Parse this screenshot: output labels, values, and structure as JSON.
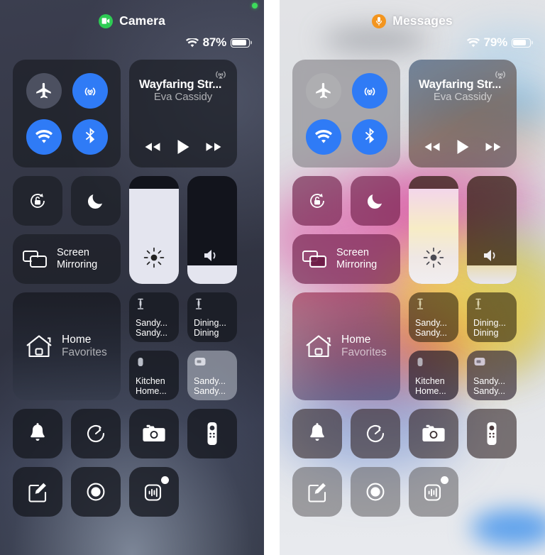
{
  "panels": [
    {
      "theme": "dark",
      "header": {
        "app_indicator_icon": "camera-icon",
        "app_indicator_label": "Camera",
        "app_indicator_color": "#2ecb54",
        "wifi_icon": "wifi-icon",
        "battery_percent": "87%",
        "battery_level": 87,
        "recording_dot": true
      },
      "connectivity": {
        "airplane": {
          "label": "Airplane Mode",
          "icon": "airplane-icon",
          "state": "off"
        },
        "airdrop": {
          "label": "AirDrop",
          "icon": "airdrop-icon",
          "state": "on"
        },
        "wifi": {
          "label": "Wi-Fi",
          "icon": "wifi-icon",
          "state": "on"
        },
        "bluetooth": {
          "label": "Bluetooth",
          "icon": "bluetooth-icon",
          "state": "on"
        }
      },
      "music": {
        "airplay_icon": "airplay-audio-icon",
        "title": "Wayfaring Str...",
        "artist": "Eva Cassidy",
        "prev_icon": "rewind-icon",
        "play_icon": "play-icon",
        "next_icon": "fast-forward-icon"
      },
      "controls": {
        "rotation_lock": {
          "icon": "rotation-lock-icon",
          "state": "off"
        },
        "do_not_disturb": {
          "icon": "moon-icon",
          "state": "off"
        },
        "screen_mirroring": {
          "icon": "screen-mirroring-icon",
          "line1": "Screen",
          "line2": "Mirroring"
        },
        "brightness": {
          "icon": "brightness-icon",
          "value": 88
        },
        "volume": {
          "icon": "speaker-icon",
          "value": 17
        }
      },
      "home": {
        "icon": "home-icon",
        "line1": "Home",
        "line2": "Favorites",
        "accessories": [
          {
            "icon": "lamp-icon",
            "line1": "Sandy...",
            "line2": "Sandy...",
            "active": false
          },
          {
            "icon": "lamp-icon",
            "line1": "Dining...",
            "line2": "Dining",
            "active": false
          },
          {
            "icon": "speaker-device-icon",
            "line1": "Kitchen",
            "line2": "Home...",
            "active": false
          },
          {
            "icon": "tv-device-icon",
            "line1": "Sandy...",
            "line2": "Sandy...",
            "active": true
          }
        ]
      },
      "shortcuts_row1": [
        {
          "icon": "bell-icon",
          "label": "Alarm"
        },
        {
          "icon": "timer-icon",
          "label": "Timer"
        },
        {
          "icon": "camera-body-icon",
          "label": "Camera"
        },
        {
          "icon": "remote-icon",
          "label": "Apple TV Remote"
        }
      ],
      "shortcuts_row2": [
        {
          "icon": "notes-icon",
          "label": "Notes"
        },
        {
          "icon": "screen-record-icon",
          "label": "Screen Recording"
        },
        {
          "icon": "sound-recognition-icon",
          "label": "Sound Recognition",
          "badge": true
        }
      ]
    },
    {
      "theme": "light",
      "header": {
        "app_indicator_icon": "microphone-icon",
        "app_indicator_label": "Messages",
        "app_indicator_color": "#f3951f",
        "wifi_icon": "wifi-icon",
        "battery_percent": "79%",
        "battery_level": 79,
        "recording_dot": false
      },
      "connectivity": {
        "airplane": {
          "label": "Airplane Mode",
          "icon": "airplane-icon",
          "state": "off"
        },
        "airdrop": {
          "label": "AirDrop",
          "icon": "airdrop-icon",
          "state": "on"
        },
        "wifi": {
          "label": "Wi-Fi",
          "icon": "wifi-icon",
          "state": "on"
        },
        "bluetooth": {
          "label": "Bluetooth",
          "icon": "bluetooth-icon",
          "state": "on"
        }
      },
      "music": {
        "airplay_icon": "airplay-audio-icon",
        "title": "Wayfaring Str...",
        "artist": "Eva Cassidy",
        "prev_icon": "rewind-icon",
        "play_icon": "play-icon",
        "next_icon": "fast-forward-icon"
      },
      "controls": {
        "rotation_lock": {
          "icon": "rotation-lock-icon",
          "state": "off"
        },
        "do_not_disturb": {
          "icon": "moon-icon",
          "state": "off"
        },
        "screen_mirroring": {
          "icon": "screen-mirroring-icon",
          "line1": "Screen",
          "line2": "Mirroring"
        },
        "brightness": {
          "icon": "brightness-icon",
          "value": 88
        },
        "volume": {
          "icon": "speaker-icon",
          "value": 17
        }
      },
      "home": {
        "icon": "home-icon",
        "line1": "Home",
        "line2": "Favorites",
        "accessories": [
          {
            "icon": "lamp-icon",
            "line1": "Sandy...",
            "line2": "Sandy...",
            "active": false
          },
          {
            "icon": "lamp-icon",
            "line1": "Dining...",
            "line2": "Dining",
            "active": false
          },
          {
            "icon": "speaker-device-icon",
            "line1": "Kitchen",
            "line2": "Home...",
            "active": false
          },
          {
            "icon": "tv-device-icon",
            "line1": "Sandy...",
            "line2": "Sandy...",
            "active": true
          }
        ]
      },
      "shortcuts_row1": [
        {
          "icon": "bell-icon",
          "label": "Alarm"
        },
        {
          "icon": "timer-icon",
          "label": "Timer"
        },
        {
          "icon": "camera-body-icon",
          "label": "Camera"
        },
        {
          "icon": "remote-icon",
          "label": "Apple TV Remote"
        }
      ],
      "shortcuts_row2": [
        {
          "icon": "notes-icon",
          "label": "Notes"
        },
        {
          "icon": "screen-record-icon",
          "label": "Screen Recording"
        },
        {
          "icon": "sound-recognition-icon",
          "label": "Sound Recognition",
          "badge": true
        }
      ]
    }
  ],
  "colors": {
    "accent_blue": "#2f7bf6",
    "camera_green": "#2ecb54",
    "mic_orange": "#f3951f",
    "tile_dark": "#1c1e26",
    "slider_fill": "#e4e5ef"
  }
}
